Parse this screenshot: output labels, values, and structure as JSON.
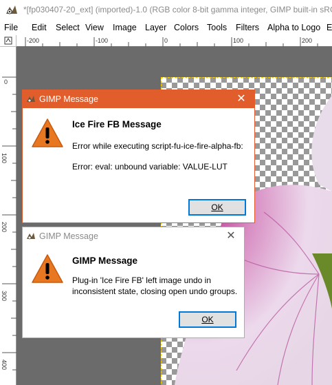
{
  "window": {
    "title": "*[fp030407-20_ext] (imported)-1.0 (RGB color 8-bit gamma integer, GIMP built-in sRG"
  },
  "menu": {
    "items": [
      "File",
      "Edit",
      "Select",
      "View",
      "Image",
      "Layer",
      "Colors",
      "Tools",
      "Filters",
      "Alpha to Logo",
      "E"
    ]
  },
  "rulers": {
    "horizontal_labels": [
      "-200",
      "-100",
      "0",
      "100",
      "200"
    ],
    "vertical_labels": [
      "0",
      "100",
      "200",
      "300",
      "400"
    ]
  },
  "dialogs": [
    {
      "title": "GIMP Message",
      "heading": "Ice Fire FB Message",
      "message_line1": "Error while executing script-fu-ice-fire-alpha-fb:",
      "message_line2": "Error: eval: unbound variable: VALUE-LUT",
      "ok_label": "OK",
      "close_label": "✕"
    },
    {
      "title": "GIMP Message",
      "heading": "GIMP Message",
      "message_line1": "Plug-in 'Ice Fire FB' left image undo in",
      "message_line2": "inconsistent state, closing open undo groups.",
      "ok_label": "OK",
      "close_label": "✕"
    }
  ],
  "colors": {
    "active_title": "#e15e2c",
    "canvas_bg": "#6b6b6b",
    "warning_orange": "#e87722",
    "selection_border": "#ffd200"
  }
}
